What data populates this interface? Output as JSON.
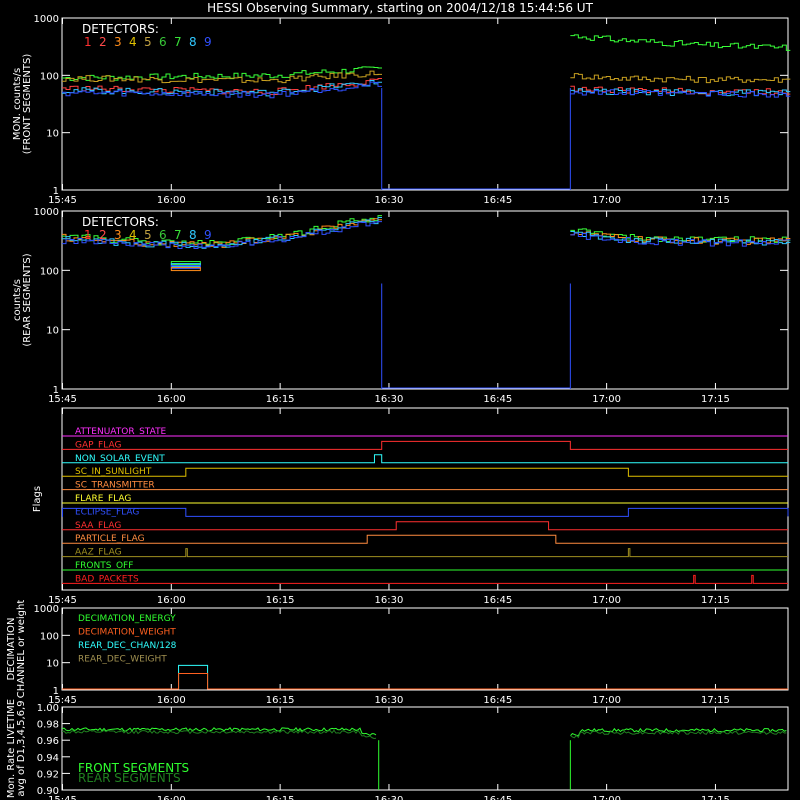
{
  "title": "HESSI Observing Summary, starting on 2004/12/18 15:44:56 UT",
  "x_ticks": [
    "15:45",
    "16:00",
    "16:15",
    "16:30",
    "16:45",
    "17:00",
    "17:15"
  ],
  "detectors": {
    "label": "DETECTORS:",
    "numbers": [
      "1",
      "2",
      "3",
      "4",
      "5",
      "6",
      "7",
      "8",
      "9"
    ],
    "colors": [
      "#ff3030",
      "#ff4a4a",
      "#ff8c1a",
      "#e0c000",
      "#c0a040",
      "#38c838",
      "#38e038",
      "#30c8ff",
      "#3050ff"
    ]
  },
  "chart_data": [
    {
      "type": "line",
      "name": "front",
      "ylabel_lines": [
        "MON. counts/s",
        "(FRONT SEGMENTS)"
      ],
      "y_scale": "log",
      "ylim": [
        1,
        1000
      ],
      "y_ticks": [
        "1",
        "10",
        "100",
        "1000"
      ],
      "x_range": [
        "15:44:56",
        "17:25:00"
      ],
      "gap": [
        "16:29",
        "16:55"
      ],
      "series": [
        {
          "color": "#38ff38",
          "pre": [
            90,
            95,
            100,
            130
          ],
          "post": [
            500,
            420,
            380,
            340,
            320,
            305
          ]
        },
        {
          "color": "#c8a020",
          "pre": [
            90,
            85,
            82,
            110
          ],
          "post": [
            100,
            90,
            88,
            85,
            85,
            84
          ]
        },
        {
          "color": "#ff4040",
          "pre": [
            60,
            55,
            52,
            80
          ],
          "post": [
            60,
            55,
            54,
            53,
            53,
            52
          ]
        },
        {
          "color": "#30c8ff",
          "pre": [
            55,
            52,
            50,
            75
          ],
          "post": [
            55,
            52,
            51,
            50,
            50,
            50
          ]
        },
        {
          "color": "#3050ff",
          "pre": [
            50,
            48,
            46,
            70
          ],
          "post": [
            52,
            50,
            48,
            48,
            47,
            47
          ]
        }
      ]
    },
    {
      "type": "line",
      "name": "rear",
      "ylabel_lines": [
        "counts/s",
        "(REAR SEGMENTS)"
      ],
      "y_scale": "log",
      "ylim": [
        1,
        1000
      ],
      "y_ticks": [
        "1",
        "10",
        "100",
        "1000"
      ],
      "gap": [
        "16:29",
        "16:55"
      ],
      "dip": [
        "16:00",
        "16:04",
        130
      ],
      "series": [
        {
          "color": "#38ff38",
          "pre": [
            380,
            300,
            280,
            420,
            800
          ],
          "post": [
            480,
            360,
            340,
            330,
            335
          ]
        },
        {
          "color": "#ff8c1a",
          "pre": [
            360,
            290,
            270,
            400,
            750
          ],
          "post": [
            440,
            340,
            320,
            310,
            315
          ]
        },
        {
          "color": "#30c8ff",
          "pre": [
            340,
            280,
            260,
            380,
            700
          ],
          "post": [
            420,
            330,
            310,
            300,
            305
          ]
        },
        {
          "color": "#3050ff",
          "pre": [
            320,
            270,
            250,
            360,
            650
          ],
          "post": [
            400,
            320,
            300,
            290,
            295
          ]
        }
      ]
    }
  ],
  "flags": {
    "ylabel": "Flags",
    "items": [
      {
        "label": "ATTENUATOR_STATE",
        "color": "#ff30ff",
        "highs": []
      },
      {
        "label": "GAP_FLAG",
        "color": "#ff3030",
        "highs": [
          [
            "16:29",
            "16:55"
          ]
        ]
      },
      {
        "label": "NON_SOLAR_EVENT",
        "color": "#30ffff",
        "highs": [
          [
            "16:28",
            "16:29"
          ]
        ]
      },
      {
        "label": "SC_IN_SUNLIGHT",
        "color": "#e0c000",
        "highs": [
          [
            "16:02",
            "17:03"
          ]
        ]
      },
      {
        "label": "SC_TRANSMITTER",
        "color": "#ff8c40",
        "highs": []
      },
      {
        "label": "FLARE_FLAG",
        "color": "#ffff30",
        "highs": []
      },
      {
        "label": "ECLIPSE_FLAG",
        "color": "#3050ff",
        "highs": [
          [
            "15:45",
            "16:02"
          ],
          [
            "17:03",
            "17:25"
          ]
        ]
      },
      {
        "label": "SAA_FLAG",
        "color": "#ff3030",
        "highs": [
          [
            "16:31",
            "16:52"
          ]
        ]
      },
      {
        "label": "PARTICLE_FLAG",
        "color": "#ff8c40",
        "highs": [
          [
            "16:27",
            "16:53"
          ]
        ]
      },
      {
        "label": "AAZ_FLAG",
        "color": "#a09020",
        "highs": [
          [
            "16:02",
            "16:02"
          ],
          [
            "17:03",
            "17:03"
          ]
        ]
      },
      {
        "label": "FRONTS_OFF",
        "color": "#30ff30",
        "highs": []
      },
      {
        "label": "BAD_PACKETS",
        "color": "#ff2020",
        "highs": [
          [
            "17:12",
            "17:12"
          ],
          [
            "17:20",
            "17:20"
          ]
        ]
      }
    ]
  },
  "decimation": {
    "ylabel_lines": [
      "DECIMATION",
      "CHANNEL or weight"
    ],
    "y_ticks": [
      "1",
      "10",
      "100",
      "1000"
    ],
    "legend": [
      {
        "label": "DECIMATION_ENERGY",
        "color": "#30ff30"
      },
      {
        "label": "DECIMATION_WEIGHT",
        "color": "#ff6020"
      },
      {
        "label": "REAR_DEC_CHAN/128",
        "color": "#30ffff"
      },
      {
        "label": "REAR_DEC_WEIGHT",
        "color": "#a09050"
      }
    ],
    "pulses": [
      {
        "color": "#30ffff",
        "start": "16:01",
        "end": "16:05",
        "value": 8
      },
      {
        "color": "#ff6020",
        "start": "16:01",
        "end": "16:05",
        "value": 4
      }
    ]
  },
  "livetime": {
    "ylabel_lines": [
      "Mon. Rate LIVETIME",
      "avg of D1,3,4,5,6,9"
    ],
    "ylim": [
      0.9,
      1.0
    ],
    "y_ticks": [
      "0.90",
      "0.92",
      "0.94",
      "0.96",
      "0.98",
      "1.00"
    ],
    "legend": [
      {
        "label": "FRONT SEGMENTS",
        "color": "#30ff30"
      },
      {
        "label": "REAR SEGMENTS",
        "color": "#208020"
      }
    ],
    "series": [
      {
        "color": "#30ff30",
        "pre": 0.973,
        "post": 0.972
      },
      {
        "color": "#208020",
        "pre": 0.97,
        "post": 0.969
      }
    ]
  }
}
